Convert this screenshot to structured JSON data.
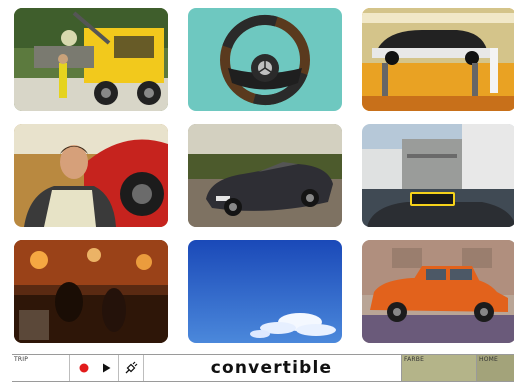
{
  "toolbar": {
    "trip_label": "TRIP",
    "word": "convertible",
    "farbe_label": "FARBE",
    "home_label": "HOME"
  },
  "colors": {
    "record": "#e21b1b",
    "farbe_bg": "#b4b489",
    "home_bg": "#a3a37a"
  },
  "tiles": [
    {
      "subject": "tow-truck"
    },
    {
      "subject": "steering-wheel"
    },
    {
      "subject": "car-on-lift"
    },
    {
      "subject": "man-with-red-car"
    },
    {
      "subject": "dark-convertible"
    },
    {
      "subject": "street-with-taxi"
    },
    {
      "subject": "bar-interior"
    },
    {
      "subject": "blue-sky"
    },
    {
      "subject": "orange-taxi"
    }
  ]
}
